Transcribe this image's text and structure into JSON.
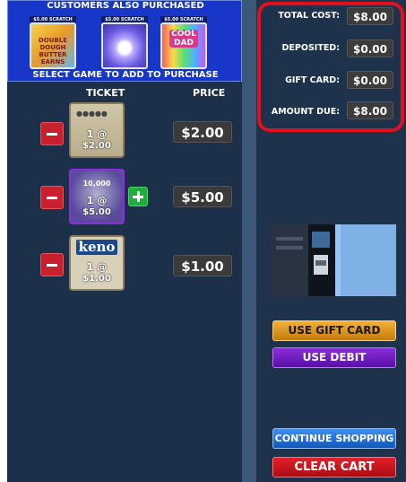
{
  "also_purchased": {
    "title": "CUSTOMERS ALSO PURCHASED",
    "select_text": "SELECT GAME TO ADD TO PURCHASE",
    "games": [
      {
        "tag": "$5.00 SCRATCH",
        "name": "DOUBLE DOUGH BUTTER EARNS"
      },
      {
        "tag": "$5.00 SCRATCH",
        "name": ""
      },
      {
        "tag": "$5.00 SCRATCH",
        "name": "COOL DAD"
      }
    ]
  },
  "cart": {
    "ticket_header": "TICKET",
    "price_header": "PRICE",
    "items": [
      {
        "qty": "1 @",
        "unit_price": "$2.00",
        "price": "$2.00"
      },
      {
        "qty": "1 @",
        "unit_price": "$5.00",
        "price": "$5.00",
        "top_text": "10,000"
      },
      {
        "qty": "1 @",
        "unit_price": "$1.00",
        "price": "$1.00",
        "logo": "keno"
      }
    ]
  },
  "totals": {
    "total_cost_label": "TOTAL COST:",
    "total_cost": "$8.00",
    "deposited_label": "DEPOSITED:",
    "deposited": "$0.00",
    "gift_card_label": "GIFT CARD:",
    "gift_card": "$0.00",
    "amount_due_label": "AMOUNT DUE:",
    "amount_due": "$8.00"
  },
  "buttons": {
    "use_gift_card": "USE GIFT CARD",
    "use_debit": "USE DEBIT",
    "continue_shopping": "CONTINUE SHOPPING",
    "clear_cart": "CLEAR CART"
  },
  "colors": {
    "highlight": "#e3101b",
    "panel": "#1c3049",
    "also_purchased_bg": "#1837c8"
  }
}
